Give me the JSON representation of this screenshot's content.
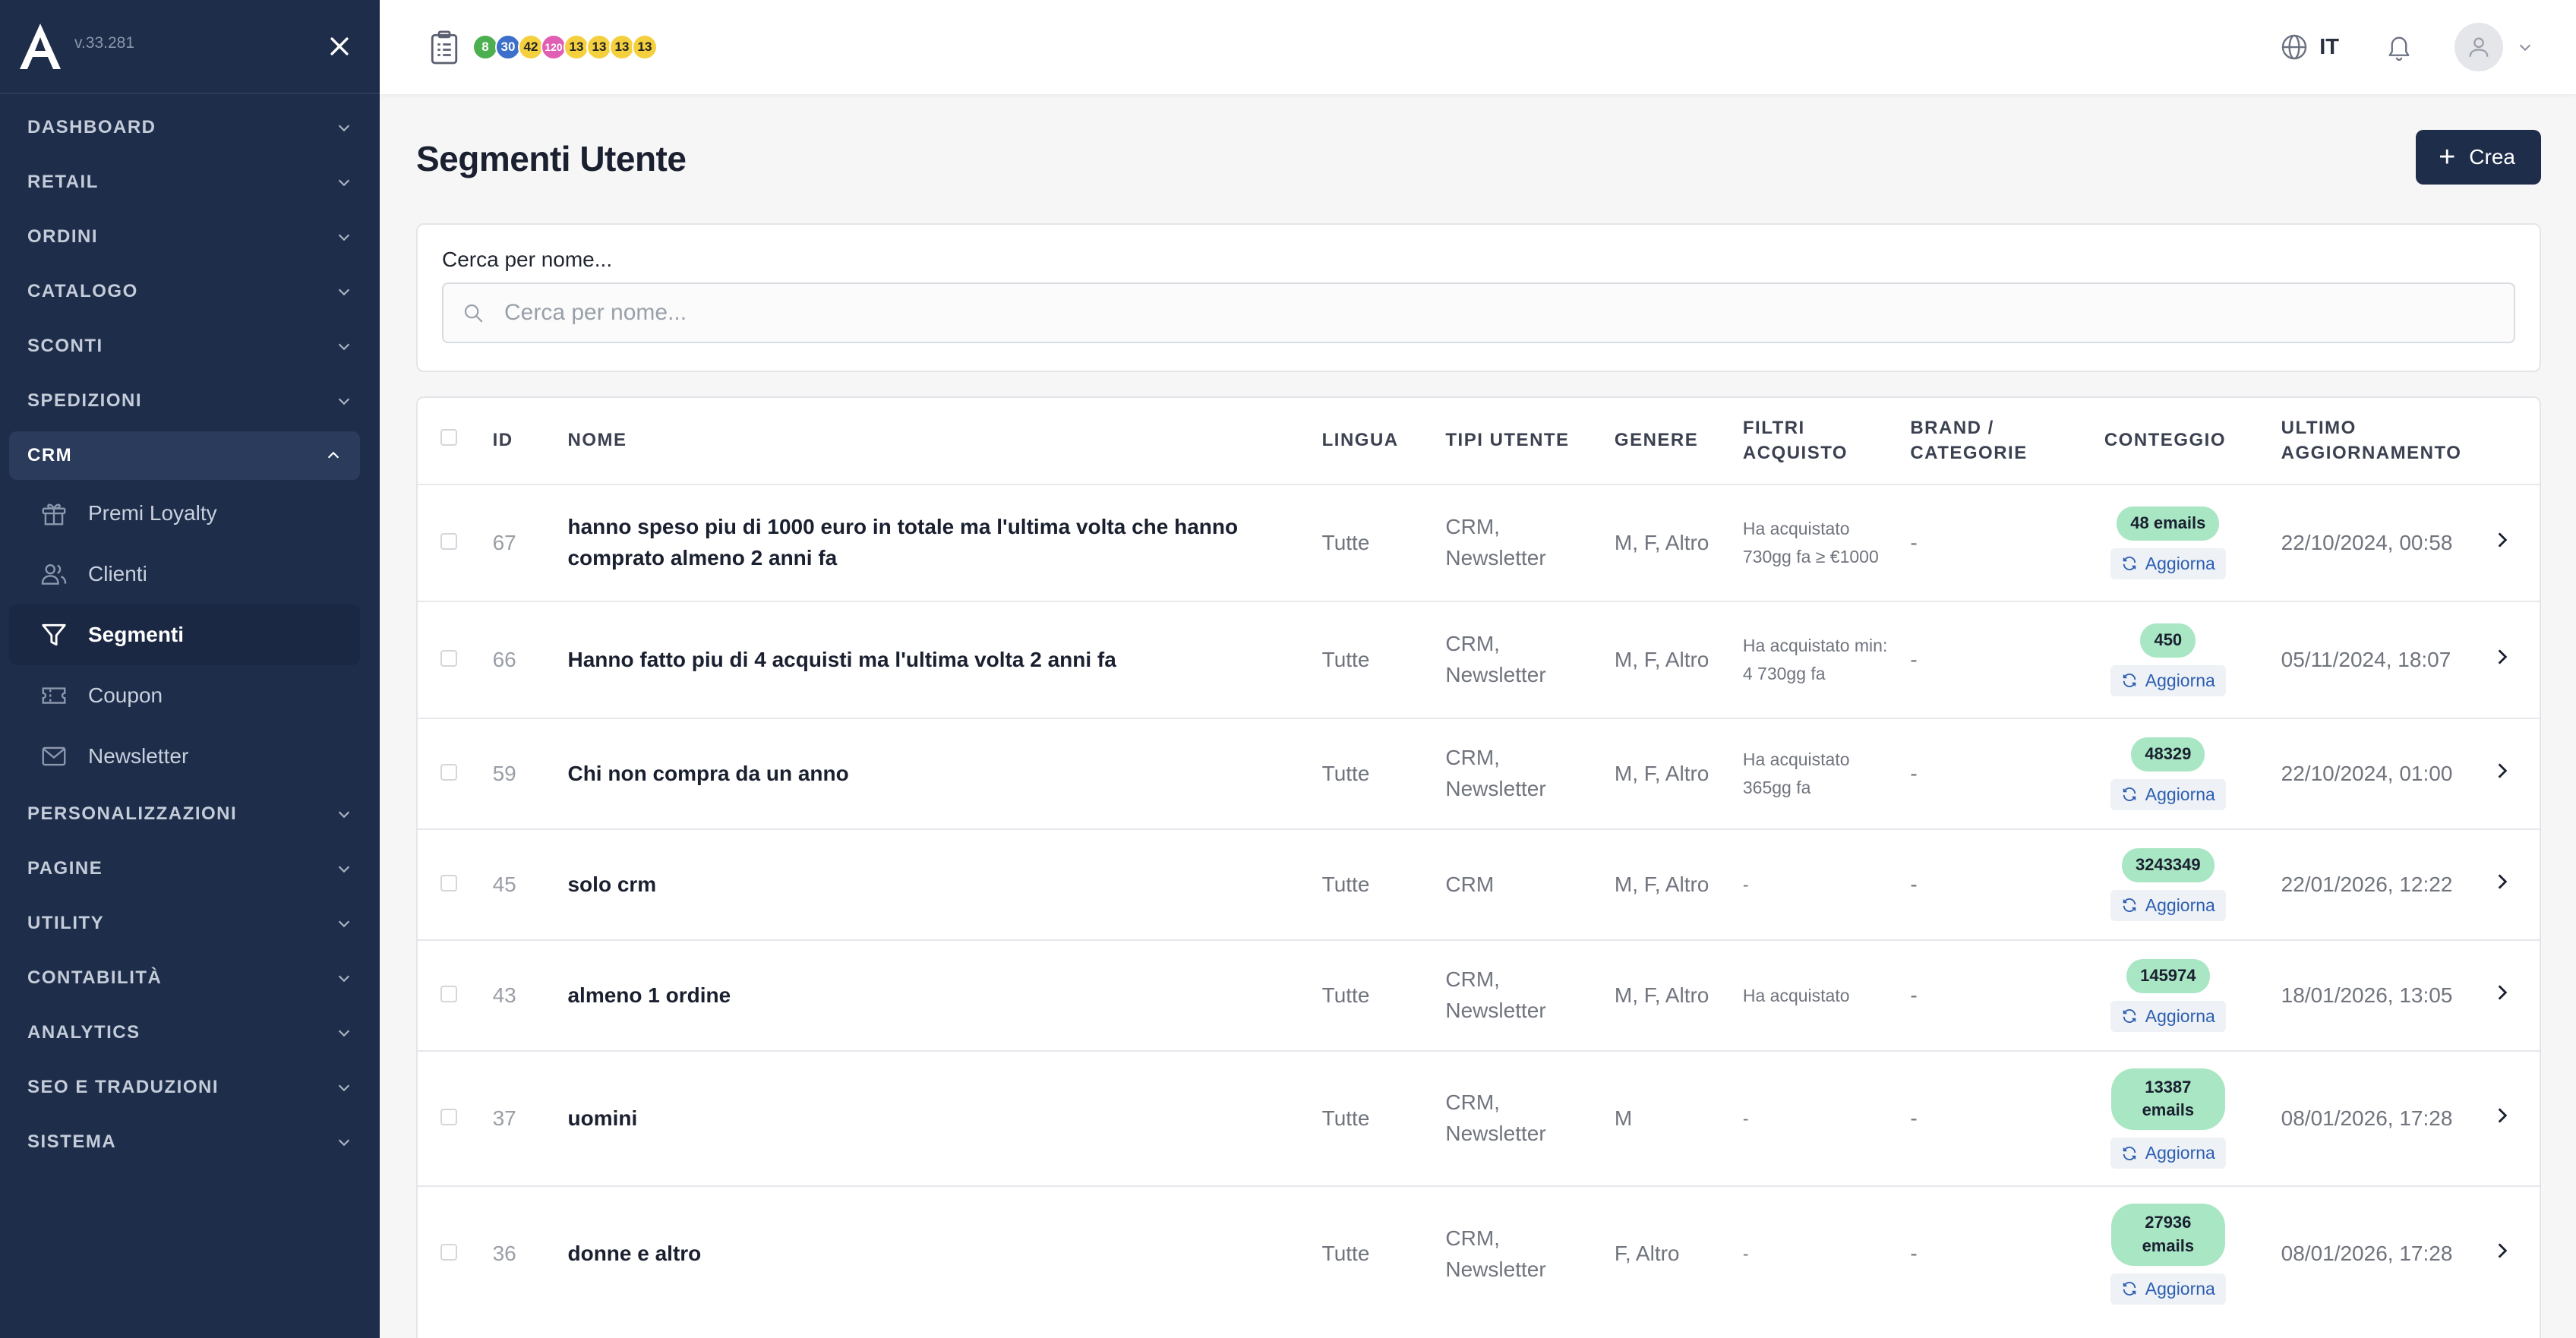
{
  "app": {
    "version": "v.33.281"
  },
  "sidebar": {
    "items": [
      {
        "label": "DASHBOARD"
      },
      {
        "label": "RETAIL"
      },
      {
        "label": "ORDINI"
      },
      {
        "label": "CATALOGO"
      },
      {
        "label": "SCONTI"
      },
      {
        "label": "SPEDIZIONI"
      },
      {
        "label": "CRM"
      },
      {
        "label": "PERSONALIZZAZIONI"
      },
      {
        "label": "PAGINE"
      },
      {
        "label": "UTILITY"
      },
      {
        "label": "CONTABILITÀ"
      },
      {
        "label": "ANALYTICS"
      },
      {
        "label": "SEO E TRADUZIONI"
      },
      {
        "label": "SISTEMA"
      }
    ],
    "crm_sub": [
      {
        "label": "Premi Loyalty",
        "icon": "gift-icon"
      },
      {
        "label": "Clienti",
        "icon": "users-icon"
      },
      {
        "label": "Segmenti",
        "icon": "filter-icon"
      },
      {
        "label": "Coupon",
        "icon": "ticket-icon"
      },
      {
        "label": "Newsletter",
        "icon": "mail-icon"
      }
    ]
  },
  "topbar": {
    "badges": [
      {
        "text": "8",
        "color": "#4caf50"
      },
      {
        "text": "30",
        "color": "#3b6fc9"
      },
      {
        "text": "42",
        "color": "#f4d03f"
      },
      {
        "text": "120",
        "color": "#e05fb4"
      },
      {
        "text": "13",
        "color": "#f4d03f"
      },
      {
        "text": "13",
        "color": "#f4d03f"
      },
      {
        "text": "13",
        "color": "#f4d03f"
      },
      {
        "text": "13",
        "color": "#f4d03f"
      }
    ],
    "language": "IT"
  },
  "page": {
    "title": "Segmenti Utente",
    "create_label": "Crea",
    "search_label": "Cerca per nome...",
    "search_placeholder": "Cerca per nome..."
  },
  "table": {
    "headers": {
      "id": "ID",
      "name": "NOME",
      "lingua": "LINGUA",
      "tipi": "TIPI UTENTE",
      "genere": "GENERE",
      "filtri": "FILTRI ACQUISTO",
      "brand": "BRAND / CATEGORIE",
      "conteggio": "CONTEGGIO",
      "ultimo": "ULTIMO AGGIORNAMENTO"
    },
    "refresh_label": "Aggiorna",
    "rows": [
      {
        "id": "67",
        "name": "hanno speso piu di 1000 euro in totale ma l'ultima volta che hanno comprato almeno 2 anni fa",
        "lingua": "Tutte",
        "tipi": "CRM, Newsletter",
        "genere": "M, F, Altro",
        "filtri": "Ha acquistato 730gg fa ≥ €1000",
        "brand": "-",
        "count": "48 emails",
        "updated": "22/10/2024, 00:58"
      },
      {
        "id": "66",
        "name": "Hanno fatto piu di 4 acquisti ma l'ultima volta 2 anni fa",
        "lingua": "Tutte",
        "tipi": "CRM, Newsletter",
        "genere": "M, F, Altro",
        "filtri": "Ha acquistato min: 4 730gg fa",
        "brand": "-",
        "count": "450",
        "updated": "05/11/2024, 18:07"
      },
      {
        "id": "59",
        "name": "Chi non compra da un anno",
        "lingua": "Tutte",
        "tipi": "CRM, Newsletter",
        "genere": "M, F, Altro",
        "filtri": "Ha acquistato 365gg fa",
        "brand": "-",
        "count": "48329",
        "updated": "22/10/2024, 01:00"
      },
      {
        "id": "45",
        "name": "solo crm",
        "lingua": "Tutte",
        "tipi": "CRM",
        "genere": "M, F, Altro",
        "filtri": "-",
        "brand": "-",
        "count": "3243349",
        "updated": "22/01/2026, 12:22"
      },
      {
        "id": "43",
        "name": "almeno 1 ordine",
        "lingua": "Tutte",
        "tipi": "CRM, Newsletter",
        "genere": "M, F, Altro",
        "filtri": "Ha acquistato",
        "brand": "-",
        "count": "145974",
        "updated": "18/01/2026, 13:05"
      },
      {
        "id": "37",
        "name": "uomini",
        "lingua": "Tutte",
        "tipi": "CRM, Newsletter",
        "genere": "M",
        "filtri": "-",
        "brand": "-",
        "count": "13387 emails",
        "updated": "08/01/2026, 17:28"
      },
      {
        "id": "36",
        "name": "donne e altro",
        "lingua": "Tutte",
        "tipi": "CRM, Newsletter",
        "genere": "F, Altro",
        "filtri": "-",
        "brand": "-",
        "count": "27936 emails",
        "updated": "08/01/2026, 17:28"
      }
    ]
  }
}
